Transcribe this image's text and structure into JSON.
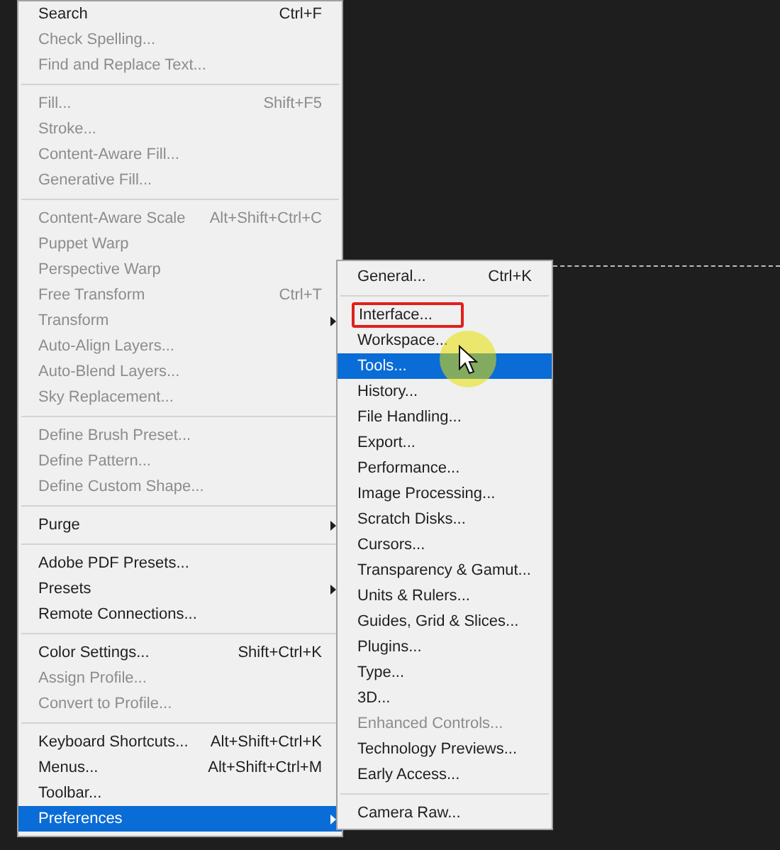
{
  "menu": {
    "items": [
      {
        "kind": "item",
        "label": "Search",
        "shortcut": "Ctrl+F",
        "disabled": false,
        "has_submenu": false,
        "selected": false
      },
      {
        "kind": "item",
        "label": "Check Spelling...",
        "disabled": true,
        "has_submenu": false,
        "selected": false
      },
      {
        "kind": "item",
        "label": "Find and Replace Text...",
        "disabled": true,
        "has_submenu": false,
        "selected": false
      },
      {
        "kind": "separator"
      },
      {
        "kind": "item",
        "label": "Fill...",
        "shortcut": "Shift+F5",
        "disabled": true,
        "has_submenu": false,
        "selected": false
      },
      {
        "kind": "item",
        "label": "Stroke...",
        "disabled": true,
        "has_submenu": false,
        "selected": false
      },
      {
        "kind": "item",
        "label": "Content-Aware Fill...",
        "disabled": true,
        "has_submenu": false,
        "selected": false
      },
      {
        "kind": "item",
        "label": "Generative Fill...",
        "disabled": true,
        "has_submenu": false,
        "selected": false
      },
      {
        "kind": "separator"
      },
      {
        "kind": "item",
        "label": "Content-Aware Scale",
        "shortcut": "Alt+Shift+Ctrl+C",
        "disabled": true,
        "has_submenu": false,
        "selected": false
      },
      {
        "kind": "item",
        "label": "Puppet Warp",
        "disabled": true,
        "has_submenu": false,
        "selected": false
      },
      {
        "kind": "item",
        "label": "Perspective Warp",
        "disabled": true,
        "has_submenu": false,
        "selected": false
      },
      {
        "kind": "item",
        "label": "Free Transform",
        "shortcut": "Ctrl+T",
        "disabled": true,
        "has_submenu": false,
        "selected": false
      },
      {
        "kind": "item",
        "label": "Transform",
        "disabled": true,
        "has_submenu": true,
        "selected": false
      },
      {
        "kind": "item",
        "label": "Auto-Align Layers...",
        "disabled": true,
        "has_submenu": false,
        "selected": false
      },
      {
        "kind": "item",
        "label": "Auto-Blend Layers...",
        "disabled": true,
        "has_submenu": false,
        "selected": false
      },
      {
        "kind": "item",
        "label": "Sky Replacement...",
        "disabled": true,
        "has_submenu": false,
        "selected": false
      },
      {
        "kind": "separator"
      },
      {
        "kind": "item",
        "label": "Define Brush Preset...",
        "disabled": true,
        "has_submenu": false,
        "selected": false
      },
      {
        "kind": "item",
        "label": "Define Pattern...",
        "disabled": true,
        "has_submenu": false,
        "selected": false
      },
      {
        "kind": "item",
        "label": "Define Custom Shape...",
        "disabled": true,
        "has_submenu": false,
        "selected": false
      },
      {
        "kind": "separator"
      },
      {
        "kind": "item",
        "label": "Purge",
        "disabled": false,
        "has_submenu": true,
        "selected": false
      },
      {
        "kind": "separator"
      },
      {
        "kind": "item",
        "label": "Adobe PDF Presets...",
        "disabled": false,
        "has_submenu": false,
        "selected": false
      },
      {
        "kind": "item",
        "label": "Presets",
        "disabled": false,
        "has_submenu": true,
        "selected": false
      },
      {
        "kind": "item",
        "label": "Remote Connections...",
        "disabled": false,
        "has_submenu": false,
        "selected": false
      },
      {
        "kind": "separator"
      },
      {
        "kind": "item",
        "label": "Color Settings...",
        "shortcut": "Shift+Ctrl+K",
        "disabled": false,
        "has_submenu": false,
        "selected": false
      },
      {
        "kind": "item",
        "label": "Assign Profile...",
        "disabled": true,
        "has_submenu": false,
        "selected": false
      },
      {
        "kind": "item",
        "label": "Convert to Profile...",
        "disabled": true,
        "has_submenu": false,
        "selected": false
      },
      {
        "kind": "separator"
      },
      {
        "kind": "item",
        "label": "Keyboard Shortcuts...",
        "shortcut": "Alt+Shift+Ctrl+K",
        "disabled": false,
        "has_submenu": false,
        "selected": false
      },
      {
        "kind": "item",
        "label": "Menus...",
        "shortcut": "Alt+Shift+Ctrl+M",
        "disabled": false,
        "has_submenu": false,
        "selected": false
      },
      {
        "kind": "item",
        "label": "Toolbar...",
        "disabled": false,
        "has_submenu": false,
        "selected": false
      },
      {
        "kind": "item",
        "label": "Preferences",
        "disabled": false,
        "has_submenu": true,
        "selected": true
      }
    ]
  },
  "submenu": {
    "items": [
      {
        "kind": "item",
        "label": "General...",
        "shortcut": "Ctrl+K",
        "disabled": false,
        "selected": false,
        "outlined": false
      },
      {
        "kind": "separator"
      },
      {
        "kind": "item",
        "label": "Interface...",
        "disabled": false,
        "selected": false,
        "outlined": true
      },
      {
        "kind": "item",
        "label": "Workspace...",
        "disabled": false,
        "selected": false,
        "outlined": false
      },
      {
        "kind": "item",
        "label": "Tools...",
        "disabled": false,
        "selected": true,
        "outlined": false
      },
      {
        "kind": "item",
        "label": "History...",
        "disabled": false,
        "selected": false,
        "outlined": false
      },
      {
        "kind": "item",
        "label": "File Handling...",
        "disabled": false,
        "selected": false,
        "outlined": false
      },
      {
        "kind": "item",
        "label": "Export...",
        "disabled": false,
        "selected": false,
        "outlined": false
      },
      {
        "kind": "item",
        "label": "Performance...",
        "disabled": false,
        "selected": false,
        "outlined": false
      },
      {
        "kind": "item",
        "label": "Image Processing...",
        "disabled": false,
        "selected": false,
        "outlined": false
      },
      {
        "kind": "item",
        "label": "Scratch Disks...",
        "disabled": false,
        "selected": false,
        "outlined": false
      },
      {
        "kind": "item",
        "label": "Cursors...",
        "disabled": false,
        "selected": false,
        "outlined": false
      },
      {
        "kind": "item",
        "label": "Transparency & Gamut...",
        "disabled": false,
        "selected": false,
        "outlined": false
      },
      {
        "kind": "item",
        "label": "Units & Rulers...",
        "disabled": false,
        "selected": false,
        "outlined": false
      },
      {
        "kind": "item",
        "label": "Guides, Grid & Slices...",
        "disabled": false,
        "selected": false,
        "outlined": false
      },
      {
        "kind": "item",
        "label": "Plugins...",
        "disabled": false,
        "selected": false,
        "outlined": false
      },
      {
        "kind": "item",
        "label": "Type...",
        "disabled": false,
        "selected": false,
        "outlined": false
      },
      {
        "kind": "item",
        "label": "3D...",
        "disabled": false,
        "selected": false,
        "outlined": false
      },
      {
        "kind": "item",
        "label": "Enhanced Controls...",
        "disabled": true,
        "selected": false,
        "outlined": false
      },
      {
        "kind": "item",
        "label": "Technology Previews...",
        "disabled": false,
        "selected": false,
        "outlined": false
      },
      {
        "kind": "item",
        "label": "Early Access...",
        "disabled": false,
        "selected": false,
        "outlined": false
      },
      {
        "kind": "separator"
      },
      {
        "kind": "item",
        "label": "Camera Raw...",
        "disabled": false,
        "selected": false,
        "outlined": false
      }
    ]
  }
}
